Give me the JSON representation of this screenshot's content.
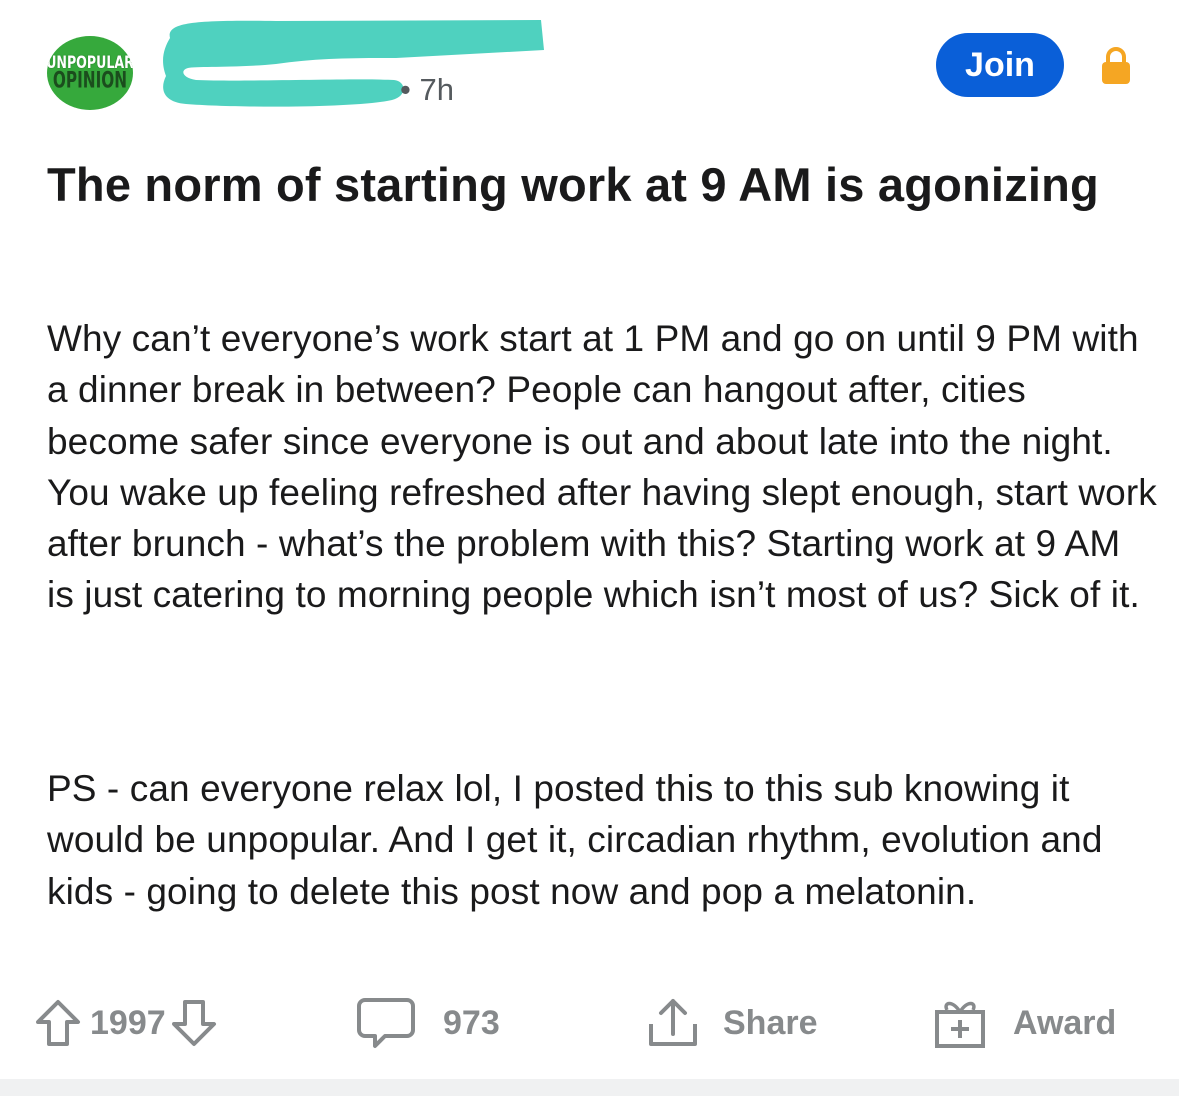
{
  "post": {
    "subreddit_icon": {
      "line1": "UNPOPULAR",
      "line2": "OPINION",
      "color": "#36a93c"
    },
    "time": "• 7h",
    "join_label": "Join",
    "title": "The norm of starting work at 9 AM is agonizing",
    "body": [
      "Why can’t everyone’s work start at 1 PM and go on until 9 PM with a dinner break in between? People can hangout after, cities become safer since everyone is out and about late into the night. You wake up feeling refreshed after having slept enough, start work after brunch - what’s the problem with this? Starting work at 9 AM is just catering to morning people which isn’t most of us? Sick of it.",
      "PS - can everyone relax lol, I posted this to this sub knowing it would be unpopular. And I get it, circadian rhythm, evolution and kids - going to delete this post now and pop a melatonin."
    ]
  },
  "actions": {
    "votes": "1997",
    "comments": "973",
    "share_label": "Share",
    "award_label": "Award"
  },
  "colors": {
    "join_button": "#0a5fd8",
    "lock": "#f5a623",
    "redaction": "#4fd1bf",
    "action_gray": "#878a8c"
  },
  "icons": [
    "upvote-icon",
    "downvote-icon",
    "comment-icon",
    "share-icon",
    "award-icon",
    "lock-icon"
  ]
}
